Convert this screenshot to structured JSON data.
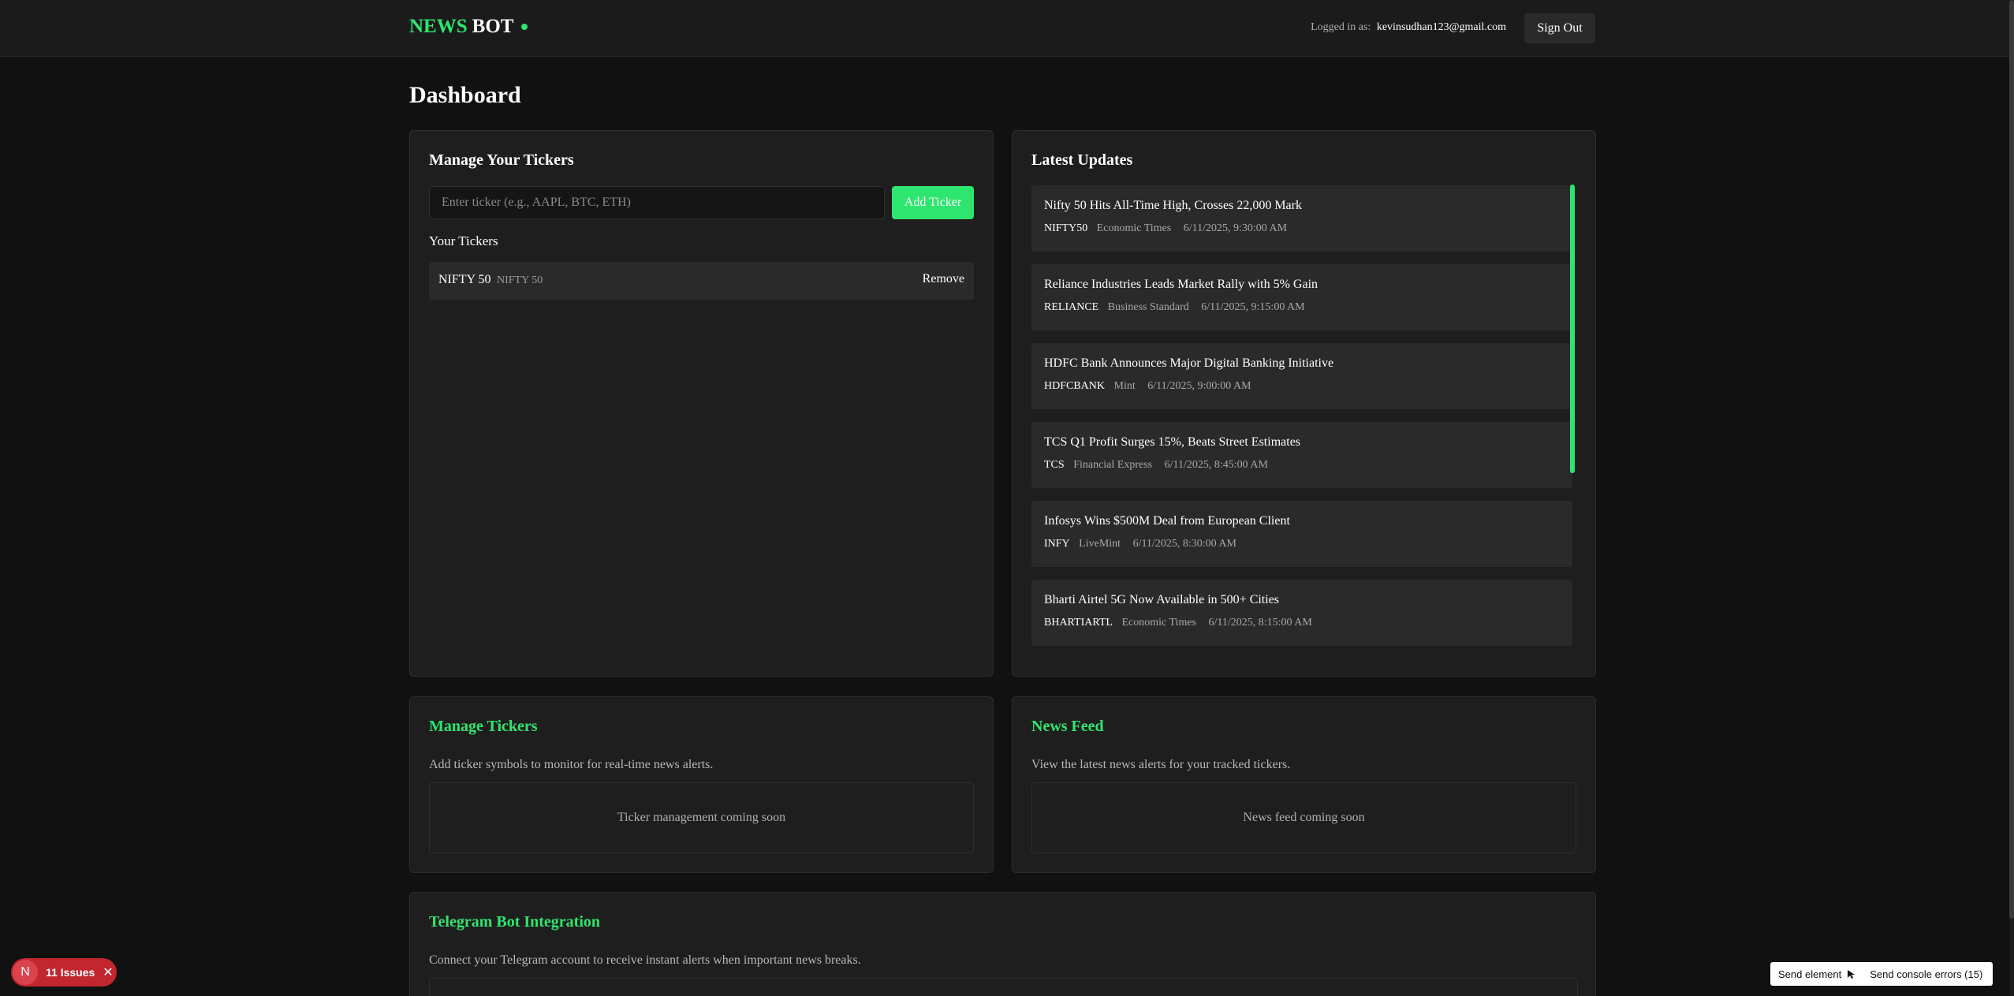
{
  "header": {
    "logo_news": "NEWS",
    "logo_bot": "BOT",
    "logged_in_label": "Logged in as:",
    "email": "kevinsudhan123@gmail.com",
    "sign_out": "Sign Out"
  },
  "page": {
    "title": "Dashboard"
  },
  "manage": {
    "title": "Manage Your Tickers",
    "input_placeholder": "Enter ticker (e.g., AAPL, BTC, ETH)",
    "add_button": "Add Ticker",
    "your_tickers": "Your Tickers",
    "tickers": [
      {
        "symbol": "NIFTY 50",
        "name": "NIFTY 50",
        "remove": "Remove"
      }
    ]
  },
  "updates": {
    "title": "Latest Updates",
    "items": [
      {
        "title": "Nifty 50 Hits All-Time High, Crosses 22,000 Mark",
        "symbol": "NIFTY50",
        "source": "Economic Times",
        "time": "6/11/2025, 9:30:00 AM"
      },
      {
        "title": "Reliance Industries Leads Market Rally with 5% Gain",
        "symbol": "RELIANCE",
        "source": "Business Standard",
        "time": "6/11/2025, 9:15:00 AM"
      },
      {
        "title": "HDFC Bank Announces Major Digital Banking Initiative",
        "symbol": "HDFCBANK",
        "source": "Mint",
        "time": "6/11/2025, 9:00:00 AM"
      },
      {
        "title": "TCS Q1 Profit Surges 15%, Beats Street Estimates",
        "symbol": "TCS",
        "source": "Financial Express",
        "time": "6/11/2025, 8:45:00 AM"
      },
      {
        "title": "Infosys Wins $500M Deal from European Client",
        "symbol": "INFY",
        "source": "LiveMint",
        "time": "6/11/2025, 8:30:00 AM"
      },
      {
        "title": "Bharti Airtel 5G Now Available in 500+ Cities",
        "symbol": "BHARTIARTL",
        "source": "Economic Times",
        "time": "6/11/2025, 8:15:00 AM"
      }
    ]
  },
  "info_cards": {
    "manage_tickers": {
      "title": "Manage Tickers",
      "desc": "Add ticker symbols to monitor for real-time news alerts.",
      "coming": "Ticker management coming soon"
    },
    "news_feed": {
      "title": "News Feed",
      "desc": "View the latest news alerts for your tracked tickers.",
      "coming": "News feed coming soon"
    },
    "telegram": {
      "title": "Telegram Bot Integration",
      "desc": "Connect your Telegram account to receive instant alerts when important news breaks."
    }
  },
  "overlay": {
    "issues_letter": "N",
    "issues_count": "11 Issues",
    "send_element": "Send element",
    "send_console": "Send console errors (15)"
  },
  "colors": {
    "accent": "#2ee66f",
    "background": "#111111",
    "card": "#1e1e1e",
    "issues": "#c2262f"
  }
}
